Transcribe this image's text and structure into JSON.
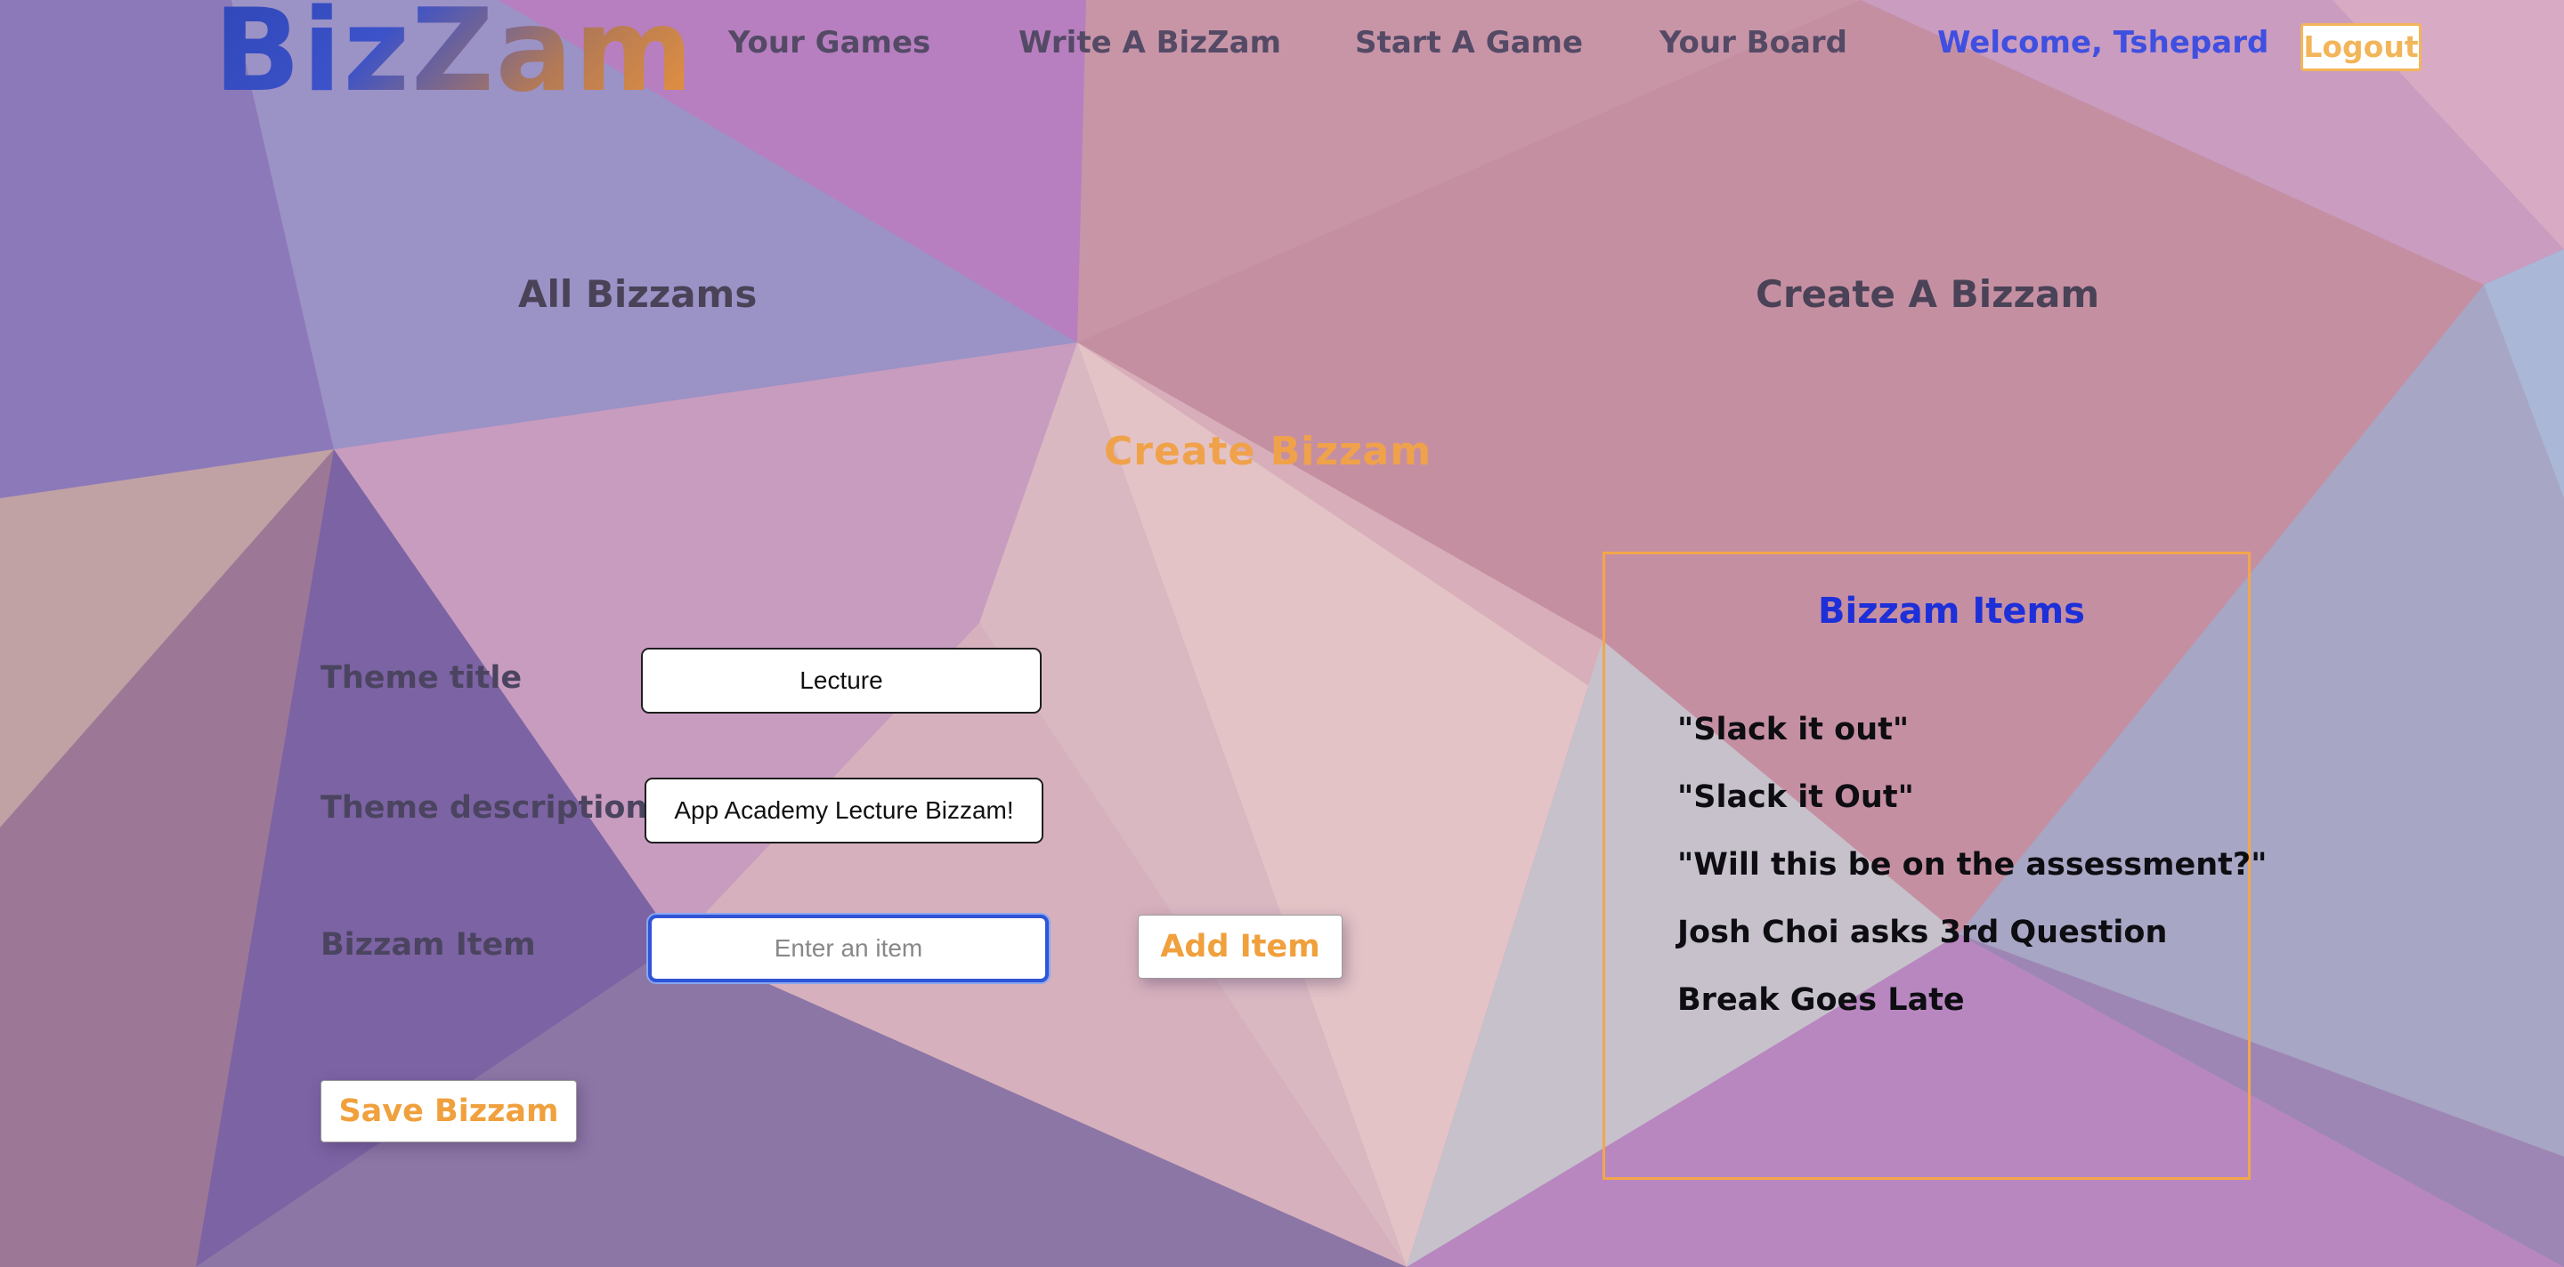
{
  "brand": {
    "logo_text": "BizZam"
  },
  "nav": {
    "your_games": "Your Games",
    "write_bizzam": "Write A BizZam",
    "start_game": "Start A Game",
    "your_board": "Your Board",
    "welcome": "Welcome, Tshepard",
    "logout": "Logout"
  },
  "sections": {
    "all_bizzams": "All Bizzams",
    "create_a_bizzam": "Create A Bizzam"
  },
  "form": {
    "heading": "Create Bizzam",
    "theme_title_label": "Theme title",
    "theme_title_value": "Lecture",
    "theme_description_label": "Theme description",
    "theme_description_value": "App Academy Lecture Bizzam!",
    "item_label": "Bizzam Item",
    "item_placeholder": "Enter an item",
    "add_item_label": "Add Item",
    "save_label": "Save Bizzam"
  },
  "items_panel": {
    "title": "Bizzam Items",
    "items": [
      "\"Slack it out\"",
      "\"Slack it Out\"",
      "\"Will this be on the assessment?\"",
      "Josh Choi asks 3rd Question",
      "Break Goes Late"
    ]
  },
  "colors": {
    "accent_orange": "#f0a03c",
    "link_blue": "#3f4fe0",
    "items_title_blue": "#1d2fd8",
    "focus_blue": "#2f55d6"
  }
}
